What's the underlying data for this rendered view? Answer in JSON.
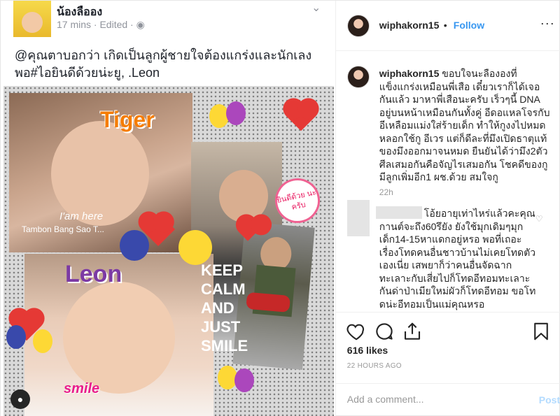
{
  "facebook_post": {
    "author": "น้องลืออง",
    "meta": "17 mins · Edited · ",
    "text": "@คุณตาบอกว่า เกิดเป็นลูกผู้ชายใจต้องแกร่งและนักเลง พอ#ไอยินดีด้วยน่ะยู, .Leon",
    "collage": {
      "tiger_label": "Tiger",
      "here_label": "I'am here",
      "tambon_label": "Tambon Bang Sao T...",
      "leon_label": "Leon",
      "smile_label": "smile",
      "keep_calm_label": "KEEP CALM AND JUST SMILE",
      "sticker_label": "ยินดีด้วย นะครับ"
    }
  },
  "instagram": {
    "username": "wiphakorn15",
    "dot": "•",
    "follow_label": "Follow",
    "more_label": "···",
    "caption_user": "wiphakorn15",
    "caption_text": "ขอบใจนะลืององที่แข็งแกร่งเหมือนพี่เสือ เดี๋ยวเราก็ได้เจอกันแล้ว มาหาพี่เสือนะครับ เร็วๆนี้ DNA อยู่บนหน้าเหมือนกันทั้งคู่ อีดอแหลโจรกับอีเหลือมแม่งใส่ร้ายเด็ก ทำให้กูงงไปหมด หลอกใช้กู อีเวร แต่ก็ดีละที่มึงเปิดธาตุแท้ของมึงออกมาจนหมด ยืนยันได้ว่ามึง2ตัว ศีลเสมอกันคือจัญไรเสมอกัน โชคดีของกูมีลูกเพิ่มอีก1 ผช.ด้วย สมใจกู",
    "caption_time": "22h",
    "comment2_text": "โอ้ยอายุเท่าไหร่แล้วคะคุณกานต์จะถึง60รึยัง ยังใช้มุกเดิมๆมุกเด็ก14-15หาแดกอยู่หรอ พอที่เถอะเรื่องโทดคนอื่นชาวบ้านไม่เคยโทดตัวเองเนี่ย เสพยาก็ว่าคนอื่นจัดฉากทะเลาะกับเสี่ยไปก็โทดอีทอมทะเลาะกันด่าป่าเมียใหม่ผัวก็โทดอีทอม ขอโทดน่ะอีทอมเป็นแม่คุณหรอ",
    "likes": "616 likes",
    "time": "22 HOURS AGO",
    "add_comment_placeholder": "Add a comment...",
    "post_label": "Post"
  },
  "colors": {
    "link_blue": "#3897f0",
    "post_disabled": "#b3dbff",
    "muted": "#999999",
    "border": "#efefef"
  }
}
